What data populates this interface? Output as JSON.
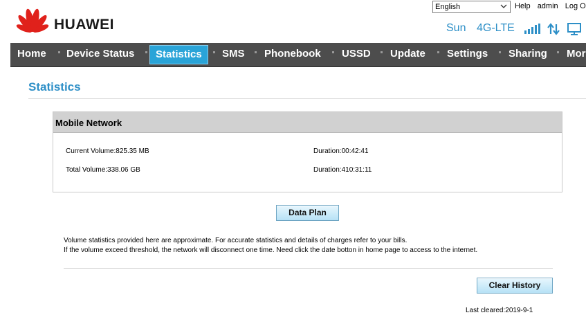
{
  "brand": {
    "name": "HUAWEI"
  },
  "header": {
    "language": {
      "selected": "English"
    },
    "links": {
      "help": "Help",
      "user": "admin",
      "logout": "Log Out"
    },
    "status": {
      "operator": "Sun",
      "network_type": "4G-LTE"
    }
  },
  "nav": {
    "items": [
      "Home",
      "Device Status",
      "Statistics",
      "SMS",
      "Phonebook",
      "USSD",
      "Update",
      "Settings",
      "Sharing",
      "More"
    ],
    "active": "Statistics"
  },
  "page": {
    "title": "Statistics"
  },
  "mobile_network": {
    "heading": "Mobile Network",
    "current_volume": "Current Volume:825.35 MB",
    "current_duration": "Duration:00:42:41",
    "total_volume": "Total Volume:338.06 GB",
    "total_duration": "Duration:410:31:11"
  },
  "buttons": {
    "data_plan": "Data Plan",
    "clear_history": "Clear History"
  },
  "notes": {
    "line1": "Volume statistics provided here are approximate. For accurate statistics and details of charges refer to your bills.",
    "line2": "If the volume exceed threshold, the network will disconnect one time. Need click the date botton in home page to access to the internet."
  },
  "last_cleared": "Last cleared:2019-9-1",
  "colors": {
    "accent": "#2d8fc7",
    "nav_bg": "#4d4d4d",
    "nav_active": "#2aa4d8",
    "logo_red": "#e0211b"
  }
}
